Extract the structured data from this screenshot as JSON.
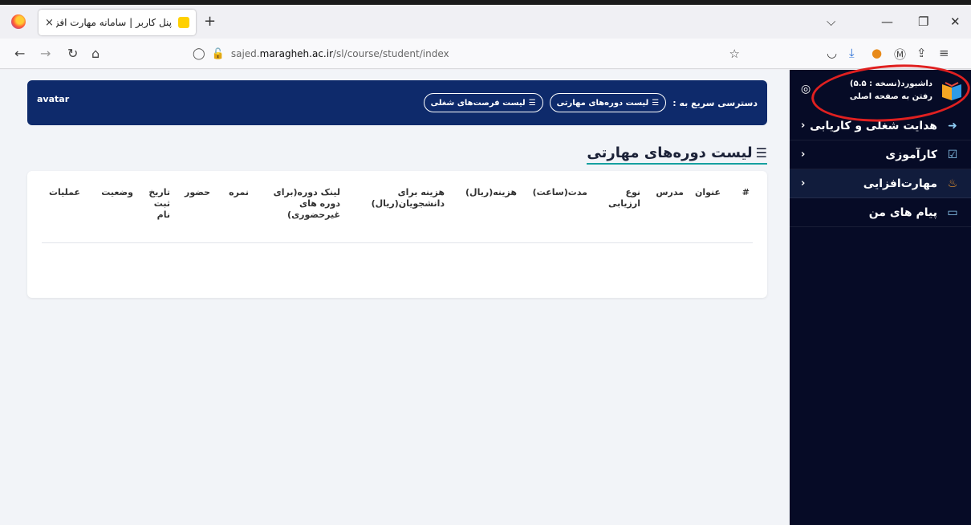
{
  "browser": {
    "tab_title": "پنل کاربر | سامانه مهارت افزایی و هدا",
    "tab_close": "×",
    "new_tab": "+",
    "url_prefix": "sajed.",
    "url_domain": "maragheh.ac.ir",
    "url_path": "/sl/course/student/index",
    "icons": [
      "back-icon",
      "forward-icon",
      "reload-icon",
      "home-icon",
      "tracking-shield-icon",
      "lock-icon",
      "bookmark-star-icon",
      "pocket-icon",
      "download-icon",
      "extension-icon",
      "account-icon",
      "share-icon",
      "menu-icon"
    ]
  },
  "header": {
    "quick_access_label": "دسترسی سریع به :",
    "quick_links": [
      {
        "label": "لیست دوره‌های مهارتی"
      },
      {
        "label": "لیست فرصت‌های شغلی"
      }
    ],
    "avatar": "avatar"
  },
  "sidebar": {
    "dashboard_title": "داشبورد(نسخه : ۵.۵)",
    "home_link": "رفتن به صفحه اصلی",
    "items": [
      {
        "label": "هدایت شغلی و کاریابی",
        "icon": "arrow-circle-icon"
      },
      {
        "label": "کارآموزی",
        "icon": "checkbox-icon"
      },
      {
        "label": "مهارت‌افزایی",
        "icon": "fire-icon"
      },
      {
        "label": "پیام های من",
        "icon": "message-icon"
      }
    ]
  },
  "main": {
    "title": "لیست دوره‌های مهارتی",
    "table_headers": [
      "#",
      "عنوان",
      "مدرس",
      "نوع ارزیابی",
      "مدت(ساعت)",
      "هزینه(ریال)",
      "هزینه برای دانشجویان(ریال)",
      "لینک دوره(برای دوره های غیرحضوری)",
      "نمره",
      "حضور",
      "تاریخ ثبت نام",
      "وضعیت",
      "عملیات"
    ]
  },
  "colors": {
    "sidebar_bg": "#060b26",
    "header_bg": "#0e2a6b",
    "title_underline": "#16a0a0",
    "annotation": "#e02020"
  }
}
